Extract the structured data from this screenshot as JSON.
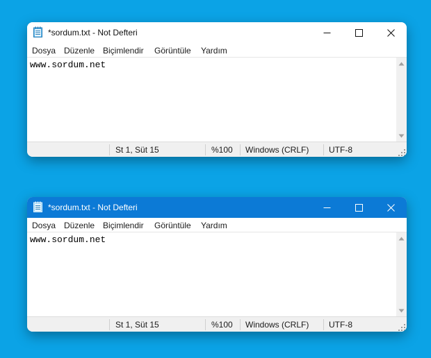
{
  "windows": [
    {
      "state": "inactive",
      "title": "*sordum.txt - Not Defteri",
      "menu": [
        "Dosya",
        "Düzenle",
        "Biçimlendir",
        "Görüntüle",
        "Yardım"
      ],
      "content": "www.sordum.net",
      "status": {
        "position": "St 1, Süt 15",
        "zoom": "%100",
        "line_ending": "Windows (CRLF)",
        "encoding": "UTF-8"
      }
    },
    {
      "state": "active",
      "title": "*sordum.txt - Not Defteri",
      "menu": [
        "Dosya",
        "Düzenle",
        "Biçimlendir",
        "Görüntüle",
        "Yardım"
      ],
      "content": "www.sordum.net",
      "status": {
        "position": "St 1, Süt 15",
        "zoom": "%100",
        "line_ending": "Windows (CRLF)",
        "encoding": "UTF-8"
      }
    }
  ],
  "colors": {
    "desktop": "#0ba3e6",
    "active_titlebar": "#0c7ad6",
    "inactive_titlebar": "#ffffff"
  },
  "icons": [
    "notepad-icon",
    "minimize-icon",
    "maximize-icon",
    "close-icon",
    "scroll-up-icon",
    "scroll-down-icon",
    "resize-grip-icon"
  ]
}
